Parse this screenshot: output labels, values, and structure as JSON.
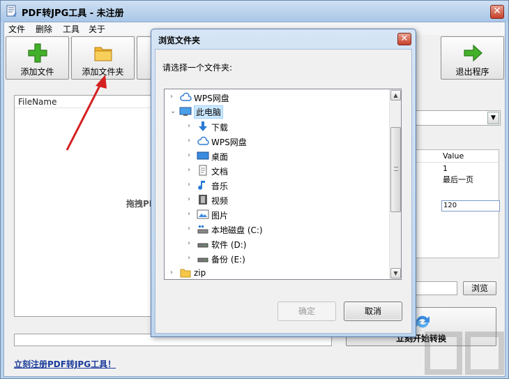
{
  "main_window": {
    "title": "PDF转JPG工具 - 未注册",
    "close_glyph": "✕"
  },
  "menu": [
    "文件",
    "删除",
    "工具",
    "关于"
  ],
  "toolbar": {
    "add_file": "添加文件",
    "add_folder": "添加文件夹",
    "exit": "退出程序"
  },
  "file_list": {
    "column_filename": "FileName",
    "drag_hint": "拖拽PI"
  },
  "properties": {
    "column_value": "Value",
    "rows": [
      "1",
      "最后一页"
    ],
    "editing_value": "120"
  },
  "browse_label": "浏览",
  "convert_label": "立刻开始转换",
  "register_link": "立刻注册PDF转JPG工具！",
  "dialog": {
    "title": "浏览文件夹",
    "close_glyph": "✕",
    "prompt": "请选择一个文件夹:",
    "ok": "确定",
    "cancel": "取消",
    "tree": [
      {
        "label": "WPS网盘",
        "icon": "cloud-icon",
        "level": 0,
        "expander": "›"
      },
      {
        "label": "此电脑",
        "icon": "computer-icon",
        "level": 0,
        "expander": "⌄",
        "selected": true
      },
      {
        "label": "下载",
        "icon": "download-icon",
        "level": 1,
        "expander": "›"
      },
      {
        "label": "WPS网盘",
        "icon": "cloud-icon",
        "level": 1,
        "expander": "›"
      },
      {
        "label": "桌面",
        "icon": "desktop-icon",
        "level": 1,
        "expander": "›"
      },
      {
        "label": "文档",
        "icon": "document-icon",
        "level": 1,
        "expander": "›"
      },
      {
        "label": "音乐",
        "icon": "music-icon",
        "level": 1,
        "expander": "›"
      },
      {
        "label": "视频",
        "icon": "video-icon",
        "level": 1,
        "expander": "›"
      },
      {
        "label": "图片",
        "icon": "picture-icon",
        "level": 1,
        "expander": "›"
      },
      {
        "label": "本地磁盘 (C:)",
        "icon": "system-drive-icon",
        "level": 1,
        "expander": "›"
      },
      {
        "label": "软件 (D:)",
        "icon": "drive-icon",
        "level": 1,
        "expander": "›"
      },
      {
        "label": "备份 (E:)",
        "icon": "drive-icon",
        "level": 1,
        "expander": "›"
      },
      {
        "label": "zip",
        "icon": "folder-icon",
        "level": 0,
        "expander": "›"
      }
    ]
  },
  "colors": {
    "title_bar": "#b8d1ec",
    "selection": "#cce8ff",
    "link": "#1b3b9b",
    "annotation_arrow": "#d42020"
  }
}
